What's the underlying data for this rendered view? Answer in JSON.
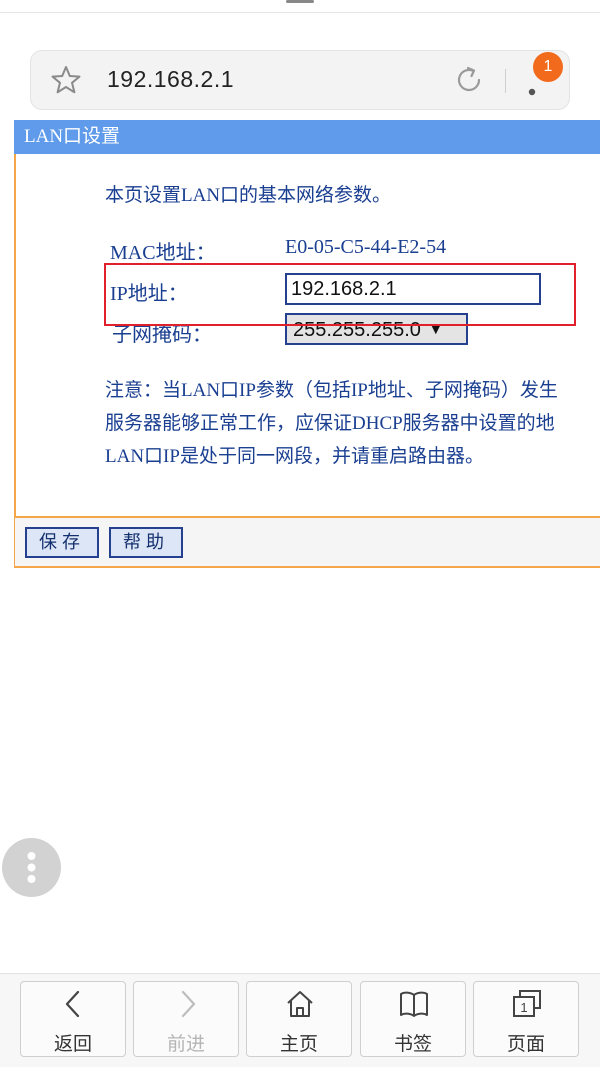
{
  "browser": {
    "url": "192.168.2.1",
    "notification_count": "1",
    "icons": [
      "star-icon",
      "refresh-icon",
      "more-vert-icon"
    ]
  },
  "router_page": {
    "title": "LAN口设置",
    "intro": "本页设置LAN口的基本网络参数。",
    "mac_label": "MAC地址：",
    "mac_value": "E0-05-C5-44-E2-54",
    "ip_label": "IP地址：",
    "ip_value": "192.168.2.1",
    "mask_label": "子网掩码：",
    "mask_value": "255.255.255.0",
    "note_lines": [
      "注意：当LAN口IP参数（包括IP地址、子网掩码）发生",
      "服务器能够正常工作，应保证DHCP服务器中设置的地",
      "LAN口IP是处于同一网段，并请重启路由器。"
    ],
    "save_label": "保存",
    "help_label": "帮助",
    "highlight_color": "#e0202a",
    "title_bar_color": "#5f9bea",
    "border_color": "#f5a54a"
  },
  "bottom_nav": {
    "items": [
      {
        "label": "返回",
        "icon": "back-icon",
        "enabled": true
      },
      {
        "label": "前进",
        "icon": "forward-icon",
        "enabled": false
      },
      {
        "label": "主页",
        "icon": "home-icon",
        "enabled": true
      },
      {
        "label": "书签",
        "icon": "bookmark-icon",
        "enabled": true
      },
      {
        "label": "页面",
        "icon": "pages-icon",
        "enabled": true,
        "count": "1"
      }
    ]
  }
}
